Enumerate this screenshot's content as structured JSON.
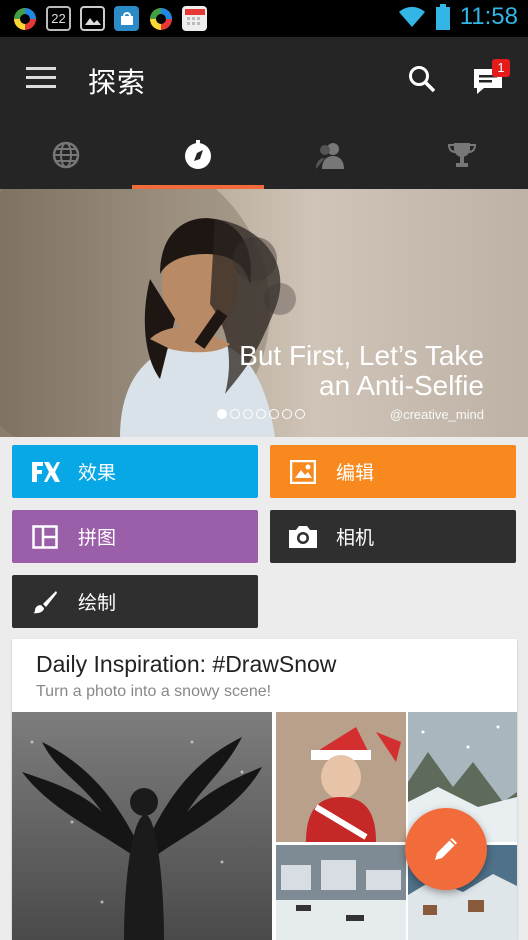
{
  "status_bar": {
    "time": "11:58",
    "calendar_date": "22",
    "icons": [
      "picsart-icon",
      "calendar-icon",
      "gallery-icon",
      "store-icon",
      "picsart-icon",
      "calendar-grid-icon"
    ]
  },
  "toolbar": {
    "title": "探索",
    "notification_count": "1"
  },
  "tabs": [
    {
      "icon": "globe-icon"
    },
    {
      "icon": "compass-icon",
      "active": true
    },
    {
      "icon": "people-icon"
    },
    {
      "icon": "trophy-icon"
    }
  ],
  "hero": {
    "line1": "But First, Let’s Take",
    "line2": "an Anti-Selfie",
    "credit": "@creative_mind",
    "page_count": 7,
    "current_page": 1
  },
  "actions": {
    "effects": "效果",
    "edit": "编辑",
    "collage": "拼图",
    "camera": "相机",
    "draw": "绘制"
  },
  "card": {
    "title": "Daily Inspiration: #DrawSnow",
    "subtitle": "Turn a photo into a snowy scene!"
  },
  "colors": {
    "accent": "#f26b3a",
    "effects": "#08a8e7",
    "edit": "#f7891f",
    "collage": "#9b5ea9",
    "dark_button": "#2f2f30",
    "bar": "#252526"
  }
}
